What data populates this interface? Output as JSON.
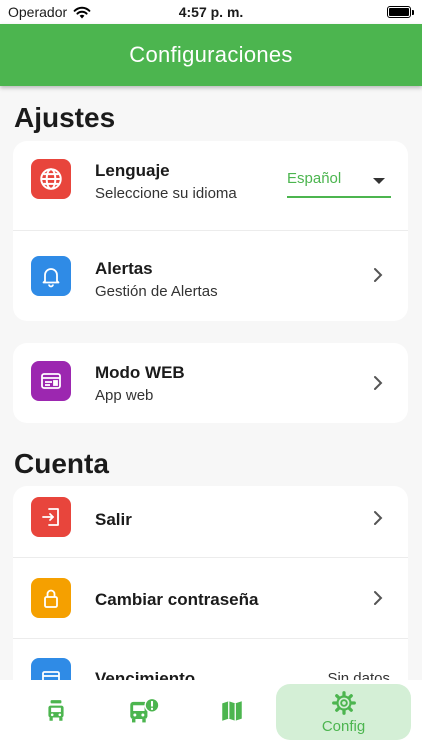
{
  "status_bar": {
    "carrier": "Operador",
    "time": "4:57 p. m.",
    "battery_level": 1.0
  },
  "header": {
    "title": "Configuraciones"
  },
  "sections": {
    "ajustes": {
      "title": "Ajustes",
      "language": {
        "title": "Lenguaje",
        "subtitle": "Seleccione su idioma",
        "selected": "Español"
      },
      "alerts": {
        "title": "Alertas",
        "subtitle": "Gestión de Alertas"
      },
      "web_mode": {
        "title": "Modo WEB",
        "subtitle": "App web"
      }
    },
    "cuenta": {
      "title": "Cuenta",
      "logout": {
        "title": "Salir"
      },
      "change_password": {
        "title": "Cambiar contraseña"
      },
      "expiration": {
        "title": "Vencimiento",
        "value": "Sin datos"
      }
    }
  },
  "bottom_nav": {
    "items": [
      {
        "icon": "bus-stop-icon",
        "label": ""
      },
      {
        "icon": "bus-alert-icon",
        "label": ""
      },
      {
        "icon": "map-icon",
        "label": ""
      },
      {
        "icon": "gear-icon",
        "label": "Config",
        "active": true
      }
    ]
  },
  "colors": {
    "primary": "#4cb54f",
    "language_icon": "#e8453c",
    "alerts_icon": "#2f8be6",
    "web_icon": "#9c27b0",
    "logout_icon": "#e8453c",
    "password_icon": "#f5a000",
    "expiration_icon": "#2f8be6",
    "active_nav_bg": "#d4efd6"
  }
}
